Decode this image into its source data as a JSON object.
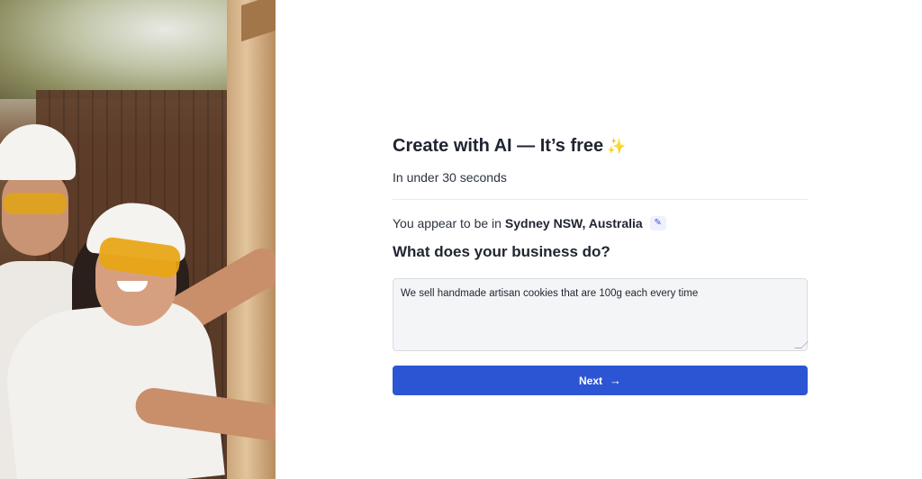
{
  "photo": {
    "description_icon": "construction-workers-photo"
  },
  "form": {
    "title": "Create with AI — It’s free",
    "title_icon": "sparkles",
    "subtitle": "In under 30 seconds",
    "location_prefix": "You appear to be in",
    "location_value": "Sydney NSW, Australia",
    "edit_icon": "pencil-icon",
    "question": "What does your business do?",
    "answer_value": "We sell handmade artisan cookies that are 100g each every time",
    "next_label": "Next",
    "next_icon": "arrow-right"
  },
  "colors": {
    "primary": "#2c55d4",
    "text": "#1f2430",
    "input_bg": "#f4f5f7",
    "sparkle": "#e7b53a"
  }
}
